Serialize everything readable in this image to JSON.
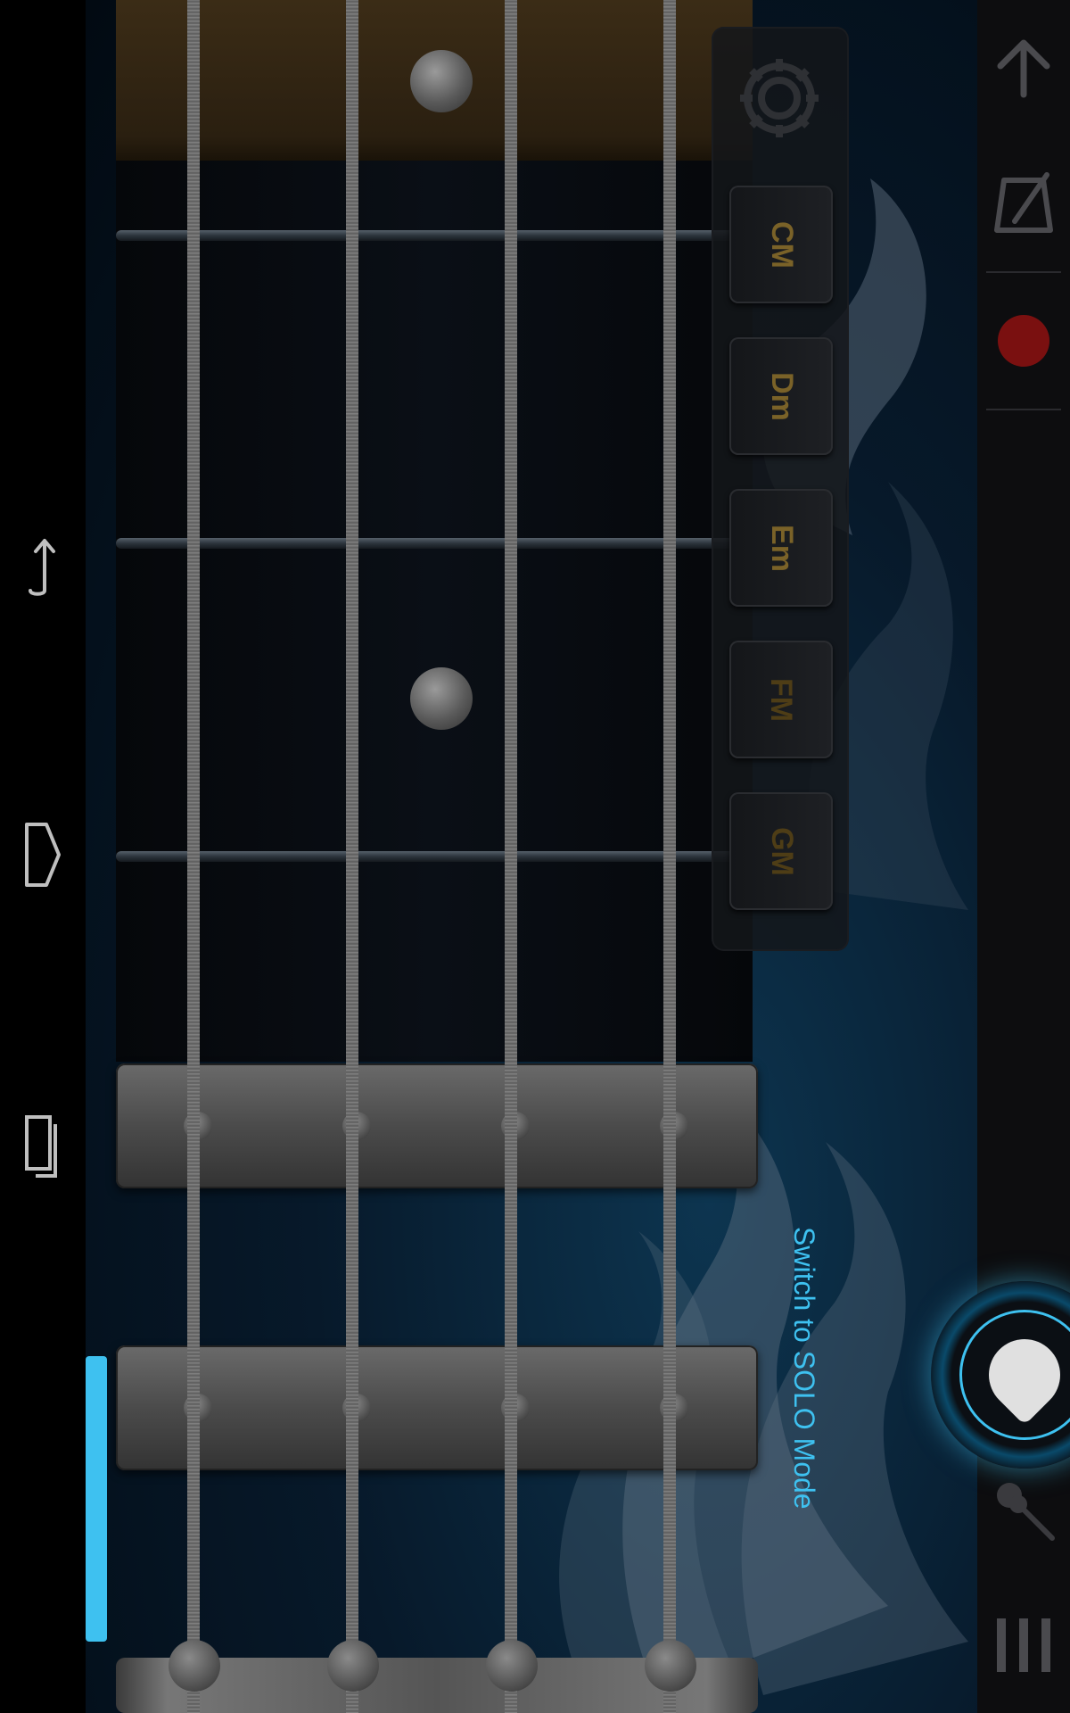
{
  "chords": [
    {
      "label": "CM",
      "dim": false
    },
    {
      "label": "Dm",
      "dim": false
    },
    {
      "label": "Em",
      "dim": false
    },
    {
      "label": "FM",
      "dim": true
    },
    {
      "label": "GM",
      "dim": true
    }
  ],
  "solo_hint": "Switch to SOLO Mode",
  "colors": {
    "accent": "#3ec1f0",
    "chord_text": "#7a6228",
    "record": "#7a1010"
  },
  "icons": {
    "nav_back": "back-arrow-icon",
    "nav_home": "home-icon",
    "nav_recent": "recent-apps-icon",
    "settings": "gear-icon",
    "up": "arrow-up-icon",
    "metronome": "metronome-icon",
    "record": "record-icon",
    "guitar": "guitar-icon",
    "menu": "menu-bars-icon",
    "pick": "guitar-pick-icon"
  }
}
